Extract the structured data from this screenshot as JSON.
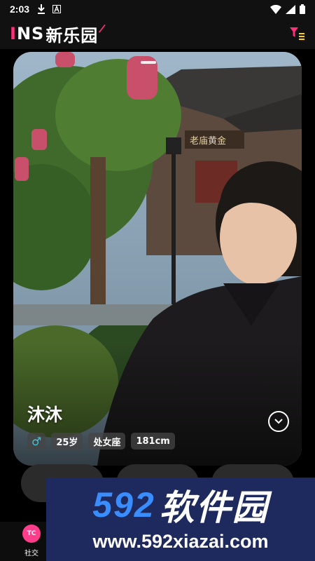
{
  "status_bar": {
    "time": "2:03",
    "icons": [
      "download-icon",
      "a-icon",
      "wifi-icon",
      "signal-icon",
      "battery-icon"
    ]
  },
  "header": {
    "logo_ins_prefix": "I",
    "logo_ins_rest": "NS",
    "logo_cn": "新乐园",
    "filter_icon": "filter-list-icon"
  },
  "profile": {
    "name": "沐沐",
    "gender_symbol": "♂",
    "age": "25岁",
    "zodiac": "处女座",
    "height": "181cm"
  },
  "actions": [
    {
      "icon": "like-icon",
      "color": "#4cd964"
    },
    {
      "icon": "chat-icon",
      "color": "#ff2f7a"
    },
    {
      "icon": "heart-icon",
      "color": "#ff2f7a"
    }
  ],
  "bottom_nav": {
    "item_label": "社交",
    "item_icon_text": "TC"
  },
  "watermark": {
    "brand_num": "592",
    "brand_text": "软件园",
    "url": "www.592xiazai.com"
  },
  "colors": {
    "accent": "#ff2f7a",
    "gender": "#3ec7d6",
    "watermark_bg": "#1e2a5e",
    "watermark_num": "#3a8dff"
  }
}
